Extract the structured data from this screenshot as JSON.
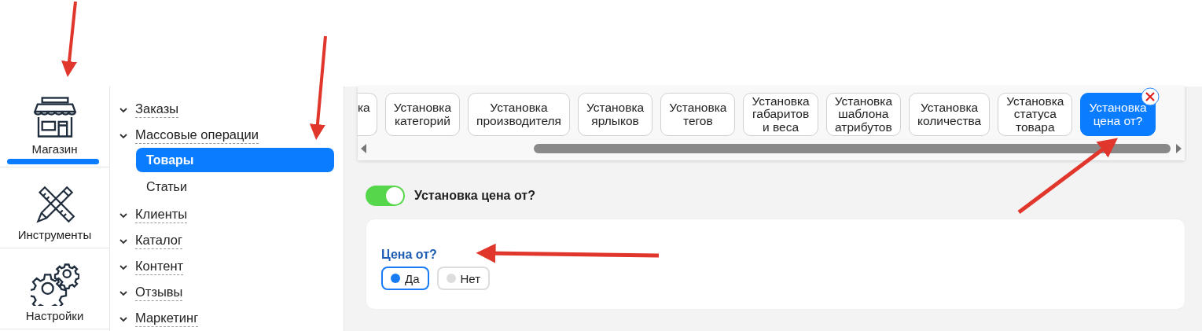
{
  "rail": [
    {
      "label": "Магазин",
      "selected": true
    },
    {
      "label": "Инструменты",
      "selected": false
    },
    {
      "label": "Настройки",
      "selected": false
    }
  ],
  "menu": [
    {
      "label": "Заказы"
    },
    {
      "label": "Массовые операции",
      "children": [
        {
          "label": "Товары",
          "selected": true
        },
        {
          "label": "Статьи",
          "selected": false
        }
      ]
    },
    {
      "label": "Клиенты"
    },
    {
      "label": "Каталог"
    },
    {
      "label": "Контент"
    },
    {
      "label": "Отзывы"
    },
    {
      "label": "Маркетинг"
    }
  ],
  "tabs": [
    {
      "label": "ка",
      "kind": "cut",
      "selected": false
    },
    {
      "label": "Установка\nкатегорий",
      "kind": "full",
      "selected": false
    },
    {
      "label": "Установка\nпроизводителя",
      "kind": "full",
      "selected": false
    },
    {
      "label": "Установка\nярлыков",
      "kind": "full",
      "selected": false
    },
    {
      "label": "Установка\nтегов",
      "kind": "full",
      "selected": false
    },
    {
      "label": "Установка\nгабаритов\nи веса",
      "kind": "full",
      "selected": false
    },
    {
      "label": "Установка\nшаблона\nатрибутов",
      "kind": "full",
      "selected": false
    },
    {
      "label": "Установка\nколичества",
      "kind": "full",
      "selected": false
    },
    {
      "label": "Установка\nстатуса\nтовара",
      "kind": "full",
      "selected": false
    },
    {
      "label": "Установка\nцена от?",
      "kind": "full",
      "selected": true
    }
  ],
  "section": {
    "on": true,
    "title": "Установка цена от?"
  },
  "field": {
    "label": "Цена от?",
    "options": [
      {
        "label": "Да",
        "selected": true
      },
      {
        "label": "Нет",
        "selected": false
      }
    ]
  }
}
